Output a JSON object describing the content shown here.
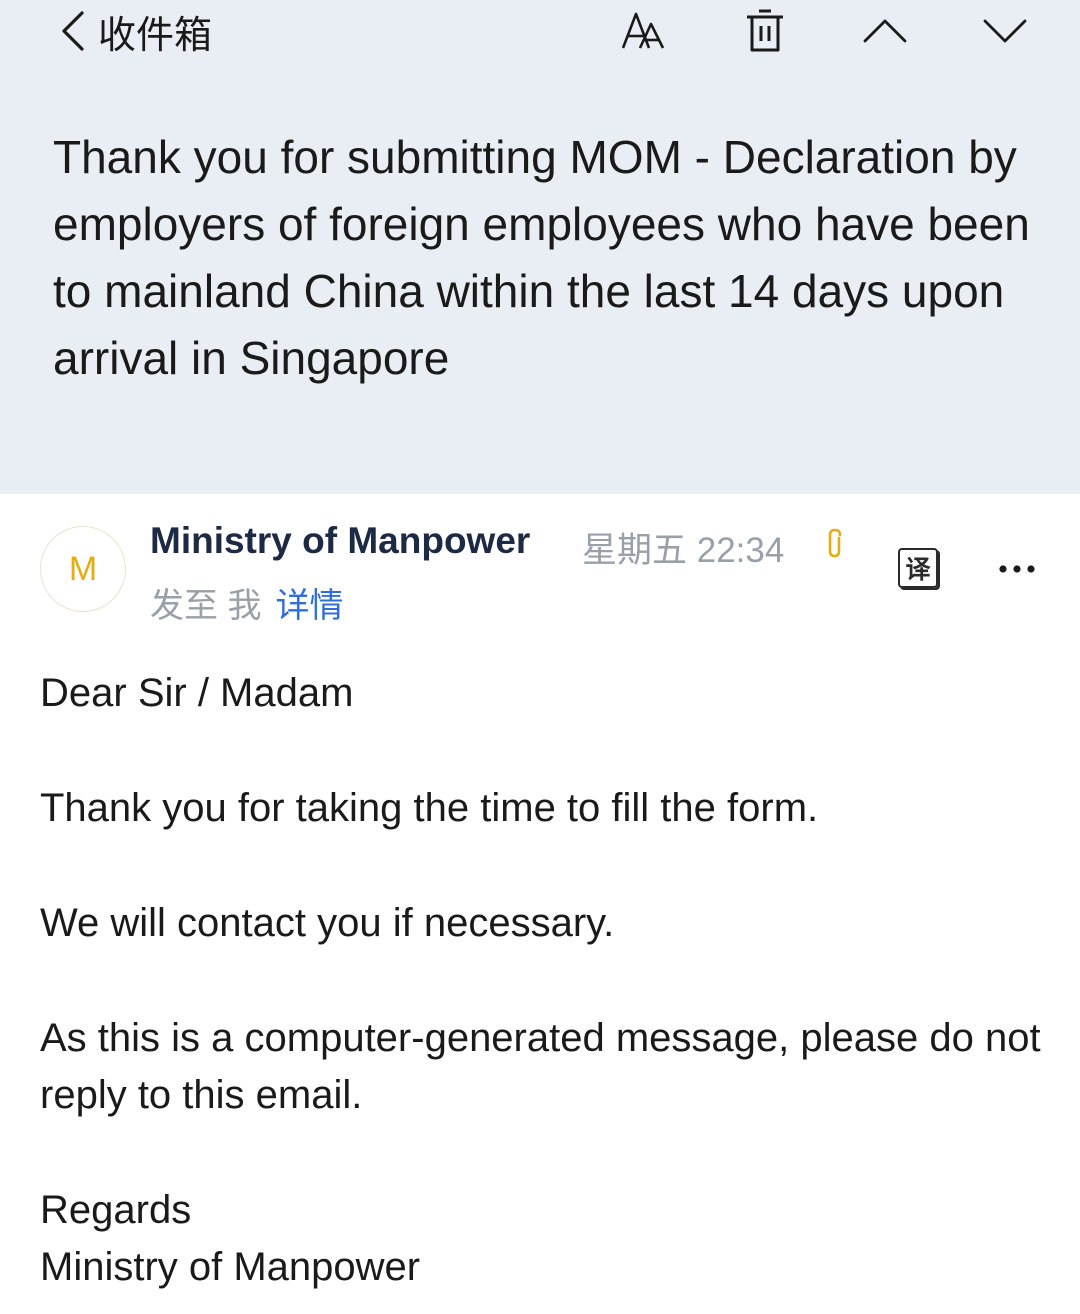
{
  "nav": {
    "back_label": "收件箱",
    "icons": [
      "font-size-icon",
      "trash-icon",
      "chevron-up-icon",
      "chevron-down-icon"
    ]
  },
  "subject": "Thank you for submitting MOM - Declaration by employers of foreign employees who have been to mainland China within the last 14 days upon arrival in Singapore",
  "sender": {
    "avatar_letter": "M",
    "name": "Ministry of Manpower",
    "date": "星期五 22:34",
    "recipient_prefix": "发至 我",
    "details_link": "详情",
    "translate_label": "译",
    "more_label": "•••"
  },
  "body": {
    "greeting": "Dear Sir / Madam",
    "line1": "Thank you for taking the time to fill the form.",
    "line2": "We will contact you if necessary.",
    "line3": "As this is a computer-generated message, please do not reply to this email.",
    "closing": "Regards",
    "signature": "Ministry of Manpower"
  },
  "colors": {
    "header_bg": "#e9eef4",
    "link": "#2f6fd6",
    "avatar_accent": "#e3ae13",
    "meta_gray": "#9aa0a8"
  }
}
